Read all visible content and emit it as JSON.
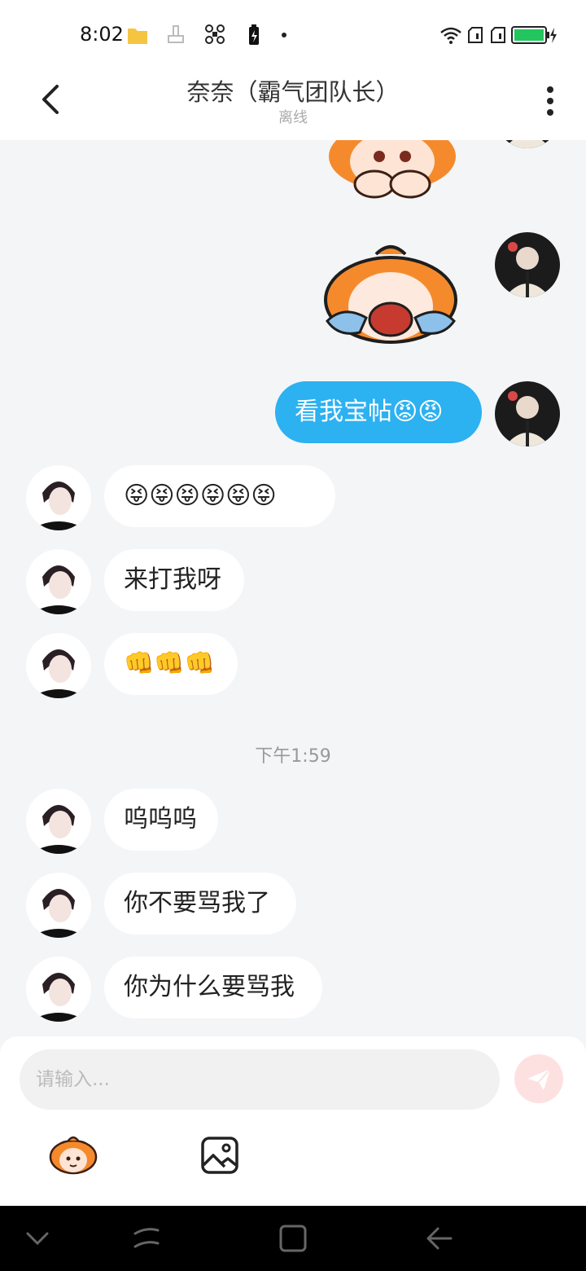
{
  "status": {
    "time": "8:02"
  },
  "header": {
    "title": "奈奈（霸气团队长）",
    "subtitle": "离线"
  },
  "messages": {
    "m1": "看我宝帖😡😡",
    "m2": "😝😝😝😝😝😝",
    "m3": "来打我呀",
    "m4": "👊👊👊",
    "divider": "下午1:59",
    "m5": "呜呜呜",
    "m6": "你不要骂我了",
    "m7": "你为什么要骂我"
  },
  "input": {
    "placeholder": "请输入..."
  },
  "icons": {
    "back": "chevron-left-icon",
    "more": "more-vertical-icon",
    "send": "send-icon",
    "emoji": "sticker-icon",
    "image": "image-icon"
  },
  "colors": {
    "accent": "#2cb1f1",
    "send_bg": "#fde1e1",
    "battery": "#22c55e"
  }
}
